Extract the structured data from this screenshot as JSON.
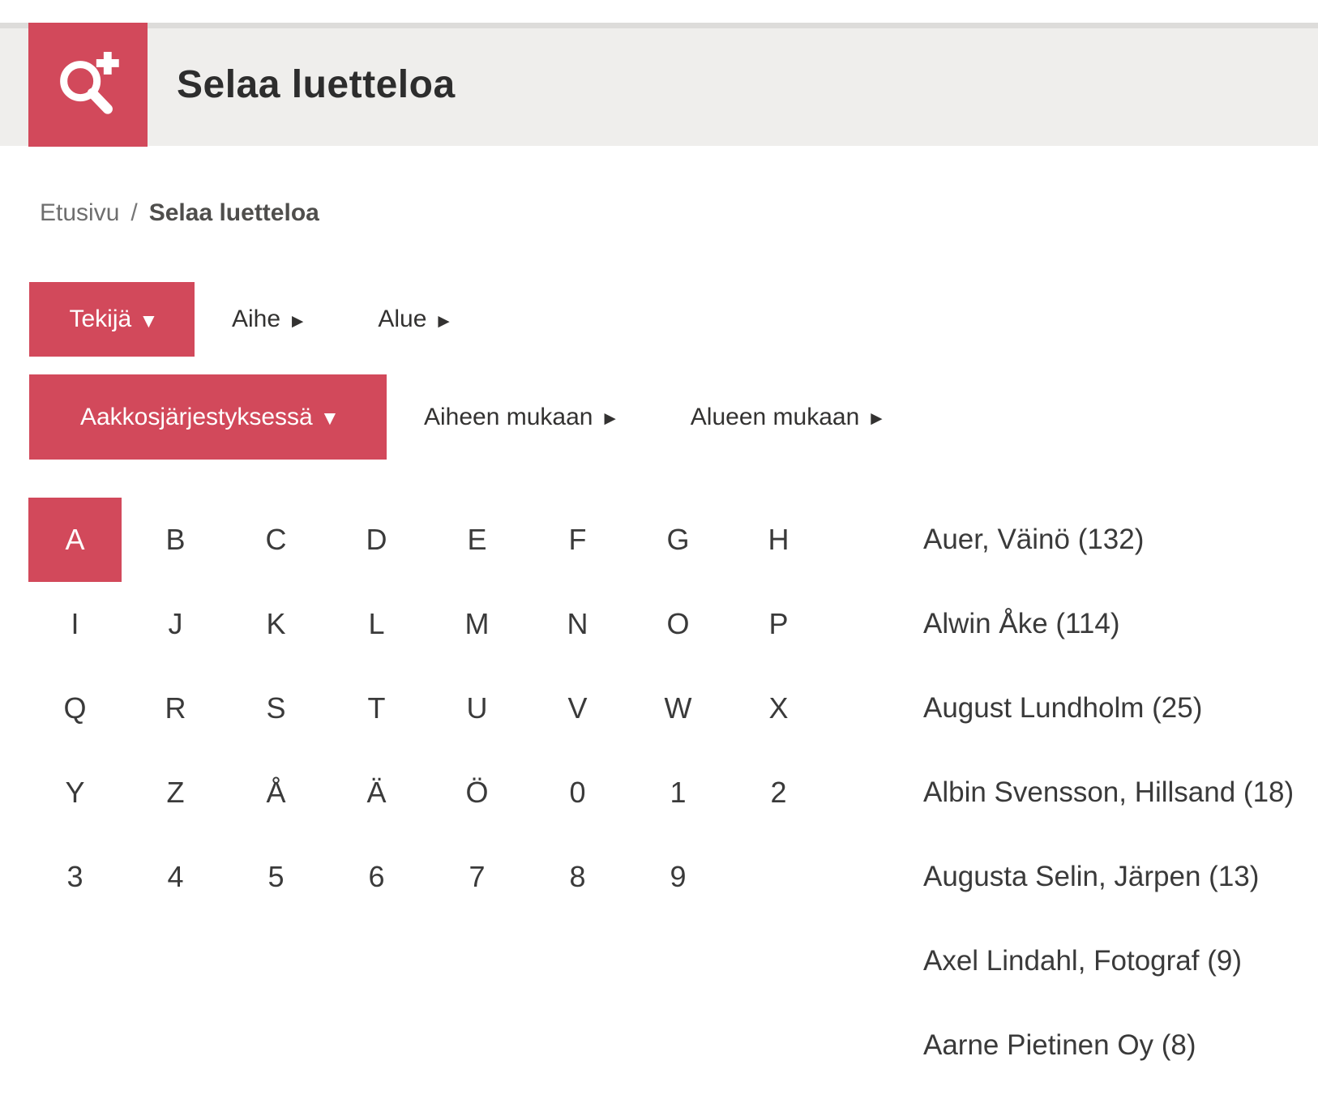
{
  "colors": {
    "accent": "#d2495b",
    "header_bg": "#efeeec",
    "header_top_border": "#dddcda",
    "title_text": "#2d2d2d",
    "body_text": "#3a3a3a",
    "breadcrumb_text": "#6e6e6e"
  },
  "header": {
    "title": "Selaa luetteloa",
    "icon": "search-plus-icon"
  },
  "breadcrumb": {
    "home": "Etusivu",
    "separator": "/",
    "current": "Selaa luetteloa"
  },
  "filter_tabs": [
    {
      "label": "Tekijä",
      "arrow": "▼",
      "active": true
    },
    {
      "label": "Aihe",
      "arrow": "▶"
    },
    {
      "label": "Alue",
      "arrow": "▶"
    }
  ],
  "sort_tabs": [
    {
      "label": "Aakkosjärjestyksessä",
      "arrow": "▼",
      "active": true
    },
    {
      "label": "Aiheen mukaan",
      "arrow": "▶"
    },
    {
      "label": "Alueen mukaan",
      "arrow": "▶"
    }
  ],
  "alphabet": [
    {
      "char": "A",
      "active": true
    },
    {
      "char": "B"
    },
    {
      "char": "C"
    },
    {
      "char": "D"
    },
    {
      "char": "E"
    },
    {
      "char": "F"
    },
    {
      "char": "G"
    },
    {
      "char": "H"
    },
    {
      "char": "I"
    },
    {
      "char": "J"
    },
    {
      "char": "K"
    },
    {
      "char": "L"
    },
    {
      "char": "M"
    },
    {
      "char": "N"
    },
    {
      "char": "O"
    },
    {
      "char": "P"
    },
    {
      "char": "Q"
    },
    {
      "char": "R"
    },
    {
      "char": "S"
    },
    {
      "char": "T"
    },
    {
      "char": "U"
    },
    {
      "char": "V"
    },
    {
      "char": "W"
    },
    {
      "char": "X"
    },
    {
      "char": "Y"
    },
    {
      "char": "Z"
    },
    {
      "char": "Å"
    },
    {
      "char": "Ä"
    },
    {
      "char": "Ö"
    },
    {
      "char": "0"
    },
    {
      "char": "1"
    },
    {
      "char": "2"
    },
    {
      "char": "3"
    },
    {
      "char": "4"
    },
    {
      "char": "5"
    },
    {
      "char": "6"
    },
    {
      "char": "7"
    },
    {
      "char": "8"
    },
    {
      "char": "9"
    }
  ],
  "authors": [
    "Auer, Väinö (132)",
    "Alwin Åke (114)",
    "August Lundholm (25)",
    "Albin Svensson, Hillsand (18)",
    "Augusta Selin, Järpen (13)",
    "Axel Lindahl, Fotograf (9)",
    "Aarne Pietinen Oy (8)"
  ]
}
